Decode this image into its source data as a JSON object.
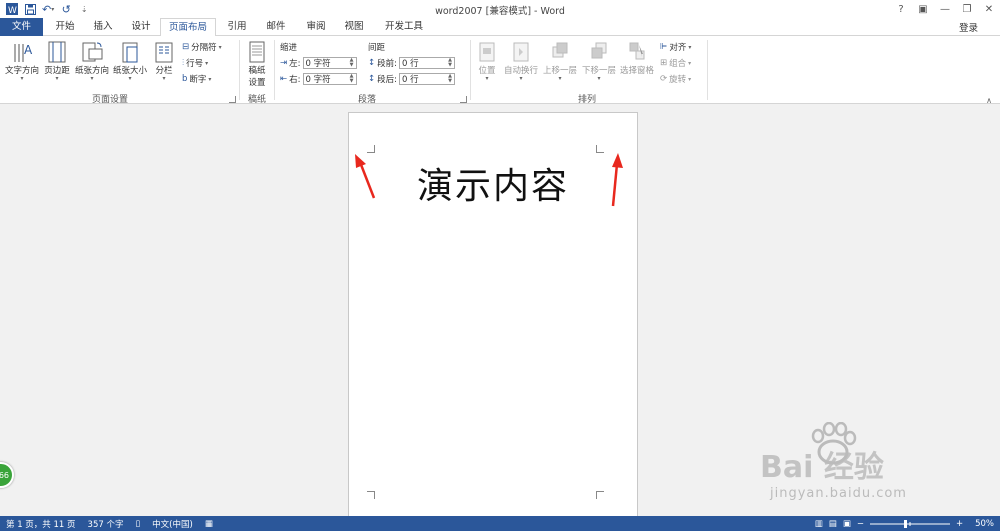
{
  "window": {
    "title": "word2007 [兼容模式] - Word",
    "controls": [
      "?",
      "▣",
      "—",
      "❐",
      "✕"
    ]
  },
  "qat": {
    "icons": [
      "word-icon",
      "save-icon",
      "undo-icon",
      "redo-icon",
      "customize-icon"
    ],
    "undo_glyph": "↶",
    "redo_glyph": "↺",
    "customize_glyph": "⇣"
  },
  "tabs": [
    "文件",
    "开始",
    "插入",
    "设计",
    "页面布局",
    "引用",
    "邮件",
    "审阅",
    "视图",
    "开发工具"
  ],
  "active_tab": "页面布局",
  "login": "登录",
  "ribbon": {
    "page_setup": {
      "label": "页面设置",
      "text_direction": "文字方向",
      "margins": "页边距",
      "orientation": "纸张方向",
      "size": "纸张大小",
      "columns": "分栏",
      "breaks": "分隔符",
      "line_numbers": "行号",
      "hyphenation": "断字"
    },
    "manuscript": {
      "label": "稿纸",
      "settings_line1": "稿纸",
      "settings_line2": "设置"
    },
    "paragraph": {
      "label": "段落",
      "indent_title": "缩进",
      "spacing_title": "间距",
      "left_label": "左:",
      "right_label": "右:",
      "before_label": "段前:",
      "after_label": "段后:",
      "left_value": "0 字符",
      "right_value": "0 字符",
      "before_value": "0 行",
      "after_value": "0 行"
    },
    "arrange": {
      "label": "排列",
      "position": "位置",
      "wrap": "自动换行",
      "forward": "上移一层",
      "backward": "下移一层",
      "selection": "选择窗格",
      "align": "对齐",
      "group": "组合",
      "rotate": "旋转"
    }
  },
  "document": {
    "content": "演示内容"
  },
  "status": {
    "page": "第 1 页，共 11 页",
    "words": "357 个字",
    "language": "中文(中国)",
    "zoom": "50%",
    "zoom_minus": "−",
    "zoom_plus": "+"
  },
  "watermark": {
    "main": "Bai 经验",
    "url": "jingyan.baidu.com"
  },
  "badge": {
    "text": "66"
  },
  "colors": {
    "accent": "#2b579a",
    "arrow": "#e8281e"
  }
}
